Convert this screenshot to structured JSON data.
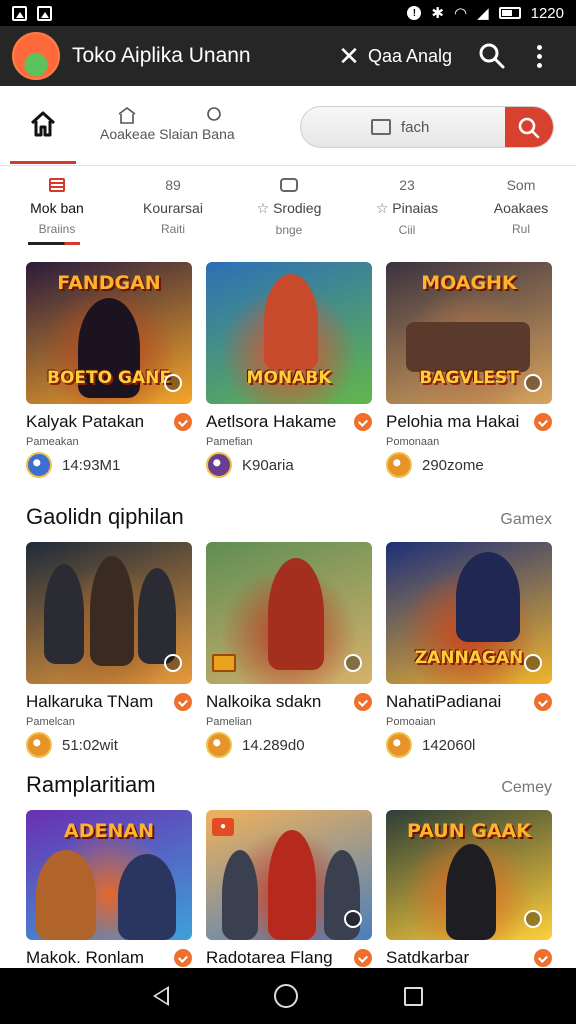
{
  "status_bar": {
    "time": "1220"
  },
  "app_bar": {
    "title": "Toko Aiplika Unann",
    "language": "Qaa Analg"
  },
  "top_nav": {
    "tab_label": "Aoakeae Slaian Bana",
    "search": {
      "placeholder": "fach"
    }
  },
  "categories": [
    {
      "icon": "list-icon",
      "name": "Mok ban",
      "sub": "Braiins"
    },
    {
      "icon": "89",
      "name": "Kourarsai",
      "sub": "Raiti"
    },
    {
      "icon": "gamepad-icon",
      "name": "Srodieg",
      "sub": "bnge"
    },
    {
      "icon": "23",
      "name": "Pinaias",
      "sub": "Ciil"
    },
    {
      "icon": "Som",
      "name": "Aoakaes",
      "sub": "Rul"
    }
  ],
  "sections": [
    {
      "title": "",
      "more": "",
      "items": [
        {
          "badge": "FANDGAN",
          "caption": "BOETO GANE",
          "name": "Kalyak Patakan",
          "developer": "Pameakan",
          "value": "14:93M1",
          "colors": [
            "#2a1b3c",
            "#b8431d",
            "#f5a629"
          ]
        },
        {
          "badge": "",
          "caption": "MONABK",
          "name": "Aetlsora Hakame",
          "developer": "Pamefian",
          "value": "K90aria",
          "colors": [
            "#2d6fb6",
            "#e54c2c",
            "#63b64b"
          ]
        },
        {
          "badge": "MOAGHK",
          "caption": "BAGVLEST",
          "name": "Pelohia ma Hakai",
          "developer": "Pomonaan",
          "value": "290zome",
          "colors": [
            "#3b3340",
            "#b0734a",
            "#d9a35c"
          ]
        }
      ]
    },
    {
      "title": "Gaolidn qiphilan",
      "more": "Gamex",
      "items": [
        {
          "badge": "",
          "caption": "",
          "name": "Halkaruka TNam",
          "developer": "Pamelcan",
          "value": "51:02wit",
          "colors": [
            "#1e2a3a",
            "#a5622a",
            "#e89a3b"
          ]
        },
        {
          "badge": "",
          "caption": "",
          "name": "Nalkoika sdakn",
          "developer": "Pamelian",
          "value": "14.289d0",
          "colors": [
            "#5f8e54",
            "#b83a23",
            "#d6b16b"
          ]
        },
        {
          "badge": "",
          "caption": "ZANNAGAN",
          "name": "NahatiPadianai",
          "developer": "Pomoaian",
          "value": "142060l",
          "colors": [
            "#1d2f79",
            "#c8461c",
            "#f1b42c"
          ]
        }
      ]
    },
    {
      "title": "Ramplaritiam",
      "more": "Cemey",
      "items": [
        {
          "badge": "ADENAN",
          "caption": "",
          "name": "Makok. Ronlam",
          "developer": "",
          "value": "",
          "colors": [
            "#6a2fb2",
            "#e3682c",
            "#3da1d8"
          ]
        },
        {
          "badge": "",
          "caption": "",
          "name": "Radotarea Flang",
          "developer": "",
          "value": "",
          "colors": [
            "#f0b25c",
            "#c43a24",
            "#4a7fbd"
          ]
        },
        {
          "badge": "PAUN GAAK",
          "caption": "",
          "name": "Satdkarbar",
          "developer": "",
          "value": "",
          "colors": [
            "#2d3f38",
            "#e06a21",
            "#ffcf3a"
          ]
        }
      ]
    }
  ],
  "meta_icon_colors": [
    "#3c6fd1",
    "#6a3e8e",
    "#e6932a"
  ]
}
